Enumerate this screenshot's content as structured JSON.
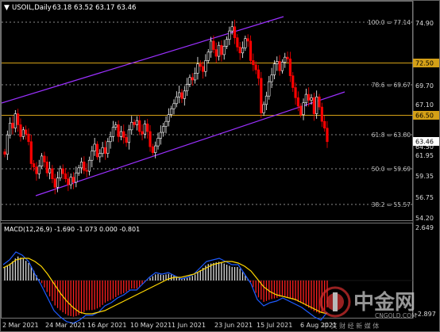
{
  "header": {
    "symbol_text": "USOIL,Daily",
    "ohlc_text": "63.18 63.52 63.17 63.46"
  },
  "levels": {
    "fib_100": "100.0 = 77.14",
    "fib_786": "78.6 = 69.67",
    "fib_618": "61.8 = 63.80",
    "fib_50": "50.0 = 59.69",
    "fib_382": "38.2 = 55.57",
    "res_7250": "72.50",
    "res_6650": "66.50",
    "current_price": "63.46"
  },
  "price_axis": [
    "74.90",
    "72.50",
    "69.70",
    "67.10",
    "66.50",
    "64.50",
    "63.46",
    "61.95",
    "59.35",
    "56.75",
    "54.20"
  ],
  "macd": {
    "label": "MACD(12,26,9) -1.690 -1.073 0.000 -0.801",
    "axis_top": "2.649",
    "axis_bottom": "-2.897"
  },
  "time_axis": [
    "2 Mar 2021",
    "24 Mar 2021",
    "16 Apr 2021",
    "10 May 2021",
    "1 Jun 2021",
    "23 Jun 2021",
    "15 Jul 2021",
    "6 Aug 2021"
  ],
  "watermark": {
    "brand_cn": "中金网",
    "domain": "CNGOLD.COM",
    "tagline_cn": "中 文 财 经 新 媒 体"
  },
  "colors": {
    "background": "#000000",
    "bull_candle": "#ffffff",
    "bear_candle": "#ff0000",
    "channel": "#9b30ff",
    "resistance_line": "#d4a017",
    "macd_signal": "#ffd700",
    "macd_main": "#1e5bff"
  },
  "chart_data": {
    "type": "candlestick",
    "symbol": "USOIL",
    "timeframe": "Daily",
    "last_price": 63.46,
    "ylim": [
      54.2,
      78.0
    ],
    "x_ticks": [
      "2 Mar 2021",
      "24 Mar 2021",
      "16 Apr 2021",
      "10 May 2021",
      "1 Jun 2021",
      "23 Jun 2021",
      "15 Jul 2021",
      "6 Aug 2021"
    ],
    "closes": [
      61.5,
      63.8,
      65.2,
      64.6,
      66.3,
      65.0,
      63.6,
      64.4,
      63.9,
      63.0,
      60.4,
      60.0,
      59.2,
      60.1,
      61.3,
      60.6,
      59.3,
      59.8,
      58.6,
      57.6,
      58.7,
      59.8,
      59.2,
      58.6,
      57.9,
      58.8,
      58.2,
      59.3,
      59.9,
      60.6,
      59.6,
      59.5,
      60.8,
      61.9,
      62.7,
      61.2,
      61.6,
      62.3,
      61.6,
      63.0,
      63.6,
      64.7,
      65.0,
      63.6,
      64.2,
      63.5,
      62.9,
      64.4,
      65.3,
      65.0,
      65.5,
      64.2,
      63.9,
      65.1,
      64.2,
      62.4,
      61.7,
      62.5,
      63.4,
      64.1,
      64.8,
      65.4,
      66.2,
      66.9,
      67.5,
      68.3,
      68.8,
      68.1,
      69.0,
      69.8,
      70.6,
      70.3,
      71.1,
      72.2,
      71.9,
      71.3,
      72.6,
      73.6,
      74.9,
      73.9,
      73.1,
      74.4,
      73.3,
      74.3,
      75.1,
      76.1,
      76.6,
      75.3,
      74.2,
      73.5,
      74.1,
      75.2,
      74.9,
      72.6,
      72.1,
      71.5,
      70.5,
      66.4,
      67.4,
      68.4,
      70.1,
      70.9,
      72.2,
      72.5,
      71.4,
      72.4,
      73.0,
      72.8,
      70.8,
      69.4,
      68.2,
      67.2,
      66.2,
      67.6,
      68.6,
      67.9,
      68.2,
      66.3,
      68.3,
      67.1,
      65.4,
      64.6,
      63.0
    ],
    "levels": [
      {
        "name": "100.0",
        "value": 77.14
      },
      {
        "name": "78.6",
        "value": 69.67
      },
      {
        "name": "61.8",
        "value": 63.8
      },
      {
        "name": "50.0",
        "value": 59.69
      },
      {
        "name": "38.2",
        "value": 55.57
      },
      {
        "name": "resistance",
        "value": 72.5
      },
      {
        "name": "support",
        "value": 66.5
      }
    ],
    "macd": {
      "params": "12,26,9",
      "ylim": [
        -2.897,
        2.649
      ],
      "main": [
        1.0,
        1.3,
        1.8,
        1.6,
        1.2,
        0.4,
        -0.3,
        -1.1,
        -1.9,
        -2.3,
        -2.6,
        -2.7,
        -2.5,
        -2.2,
        -2.2,
        -2.0,
        -1.6,
        -1.4,
        -1.1,
        -0.9,
        -0.6,
        -0.6,
        -0.2,
        0.2,
        0.5,
        0.4,
        0.5,
        0.3,
        0.1,
        0.2,
        0.4,
        0.8,
        1.2,
        1.3,
        1.4,
        1.2,
        1.0,
        1.0,
        0.4,
        -0.2,
        -1.2,
        -1.6,
        -1.4,
        -1.3,
        -1.1,
        -1.3,
        -1.5,
        -1.7,
        -2.0,
        -2.3,
        -2.5,
        -2.0
      ],
      "signal": [
        0.8,
        1.0,
        1.3,
        1.4,
        1.4,
        1.2,
        0.9,
        0.4,
        -0.2,
        -0.8,
        -1.3,
        -1.7,
        -2.0,
        -2.1,
        -2.1,
        -2.0,
        -1.9,
        -1.7,
        -1.5,
        -1.3,
        -1.1,
        -0.9,
        -0.7,
        -0.5,
        -0.3,
        -0.1,
        0.1,
        0.2,
        0.2,
        0.3,
        0.4,
        0.6,
        0.8,
        1.0,
        1.1,
        1.2,
        1.2,
        1.1,
        0.9,
        0.6,
        0.1,
        -0.4,
        -0.7,
        -0.9,
        -1.0,
        -1.1,
        -1.2,
        -1.4,
        -1.6,
        -1.8,
        -2.0,
        -2.1
      ]
    }
  }
}
